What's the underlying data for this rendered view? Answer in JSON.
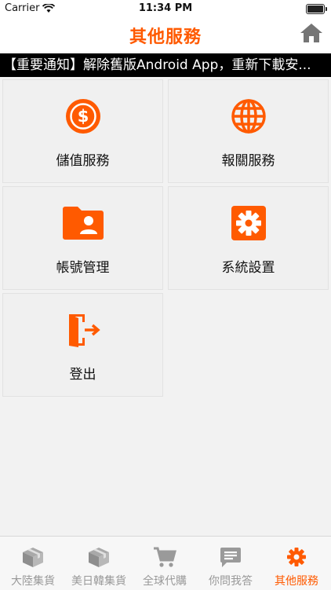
{
  "status_bar": {
    "carrier": "Carrier",
    "time": "11:34 PM"
  },
  "header": {
    "title": "其他服務"
  },
  "notice": {
    "text": "【重要通知】解除舊版Android App，重新下載安..."
  },
  "tiles": [
    {
      "label": "儲值服務",
      "icon": "dollar-circle-icon"
    },
    {
      "label": "報關服務",
      "icon": "globe-icon"
    },
    {
      "label": "帳號管理",
      "icon": "account-folder-icon"
    },
    {
      "label": "系統設置",
      "icon": "gear-icon"
    },
    {
      "label": "登出",
      "icon": "logout-door-icon"
    }
  ],
  "tabs": [
    {
      "label": "大陸集貨",
      "icon": "package-icon"
    },
    {
      "label": "美日韓集貨",
      "icon": "package-icon"
    },
    {
      "label": "全球代購",
      "icon": "shopping-cart-icon"
    },
    {
      "label": "你問我答",
      "icon": "chat-icon"
    },
    {
      "label": "其他服務",
      "icon": "gear-icon",
      "active": true
    }
  ],
  "colors": {
    "accent": "#ff5a00",
    "inactive": "#999999"
  }
}
